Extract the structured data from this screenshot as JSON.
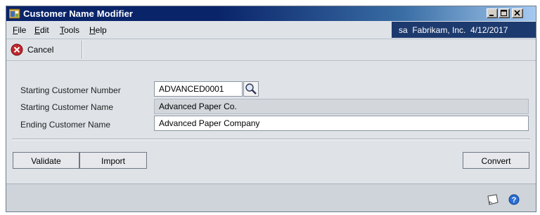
{
  "window": {
    "title": "Customer Name Modifier"
  },
  "menu": {
    "file": {
      "first": "F",
      "rest": "ile"
    },
    "edit": {
      "first": "E",
      "rest": "dit"
    },
    "tools": {
      "first": "T",
      "rest": "ools"
    },
    "help": {
      "first": "H",
      "rest": "elp"
    }
  },
  "company_info": "sa  Fabrikam, Inc.  4/12/2017",
  "toolbar": {
    "cancel_label": "Cancel"
  },
  "form": {
    "starting_customer_number_label": "Starting Customer Number",
    "starting_customer_number_value": "ADVANCED0001",
    "starting_customer_name_label": "Starting Customer Name",
    "starting_customer_name_value": "Advanced Paper Co.",
    "ending_customer_name_label": "Ending Customer Name",
    "ending_customer_name_value": "Advanced Paper Company"
  },
  "buttons": {
    "validate": "Validate",
    "import": "Import",
    "convert": "Convert"
  },
  "icons": {
    "app": "app-window-icon",
    "cancel": "cancel-icon",
    "lookup": "lookup-magnifier-icon",
    "note": "note-icon",
    "help": "help-icon"
  },
  "colors": {
    "titlebar_start": "#0a246a",
    "titlebar_end": "#a6caf0",
    "company_info_bg": "#1d3a6e",
    "window_bg": "#dfe3e8",
    "cancel_red": "#c0272d",
    "help_blue": "#2b6fd6"
  }
}
